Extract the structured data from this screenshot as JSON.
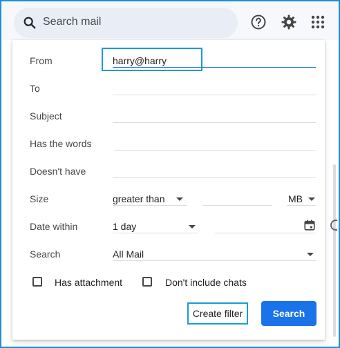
{
  "header": {
    "search_placeholder": "Search mail",
    "icons": [
      "search-icon",
      "help-icon",
      "gear-icon",
      "apps-grid-icon"
    ]
  },
  "filter_form": {
    "from_label": "From",
    "from_value": "harry@harry",
    "to_label": "To",
    "subject_label": "Subject",
    "has_words_label": "Has the words",
    "doesnt_have_label": "Doesn't have",
    "size_label": "Size",
    "size_operator": "greater than",
    "size_unit": "MB",
    "date_within_label": "Date within",
    "date_within_value": "1 day",
    "search_label": "Search",
    "search_scope": "All Mail",
    "has_attachment_label": "Has attachment",
    "dont_include_chats_label": "Don't include chats",
    "create_filter_label": "Create filter",
    "search_button_label": "Search"
  },
  "colors": {
    "accent": "#1a73e8",
    "highlight_border": "#1a9bd7",
    "header_bg": "#f6f8fc",
    "searchbar_bg": "#e9eef6"
  }
}
